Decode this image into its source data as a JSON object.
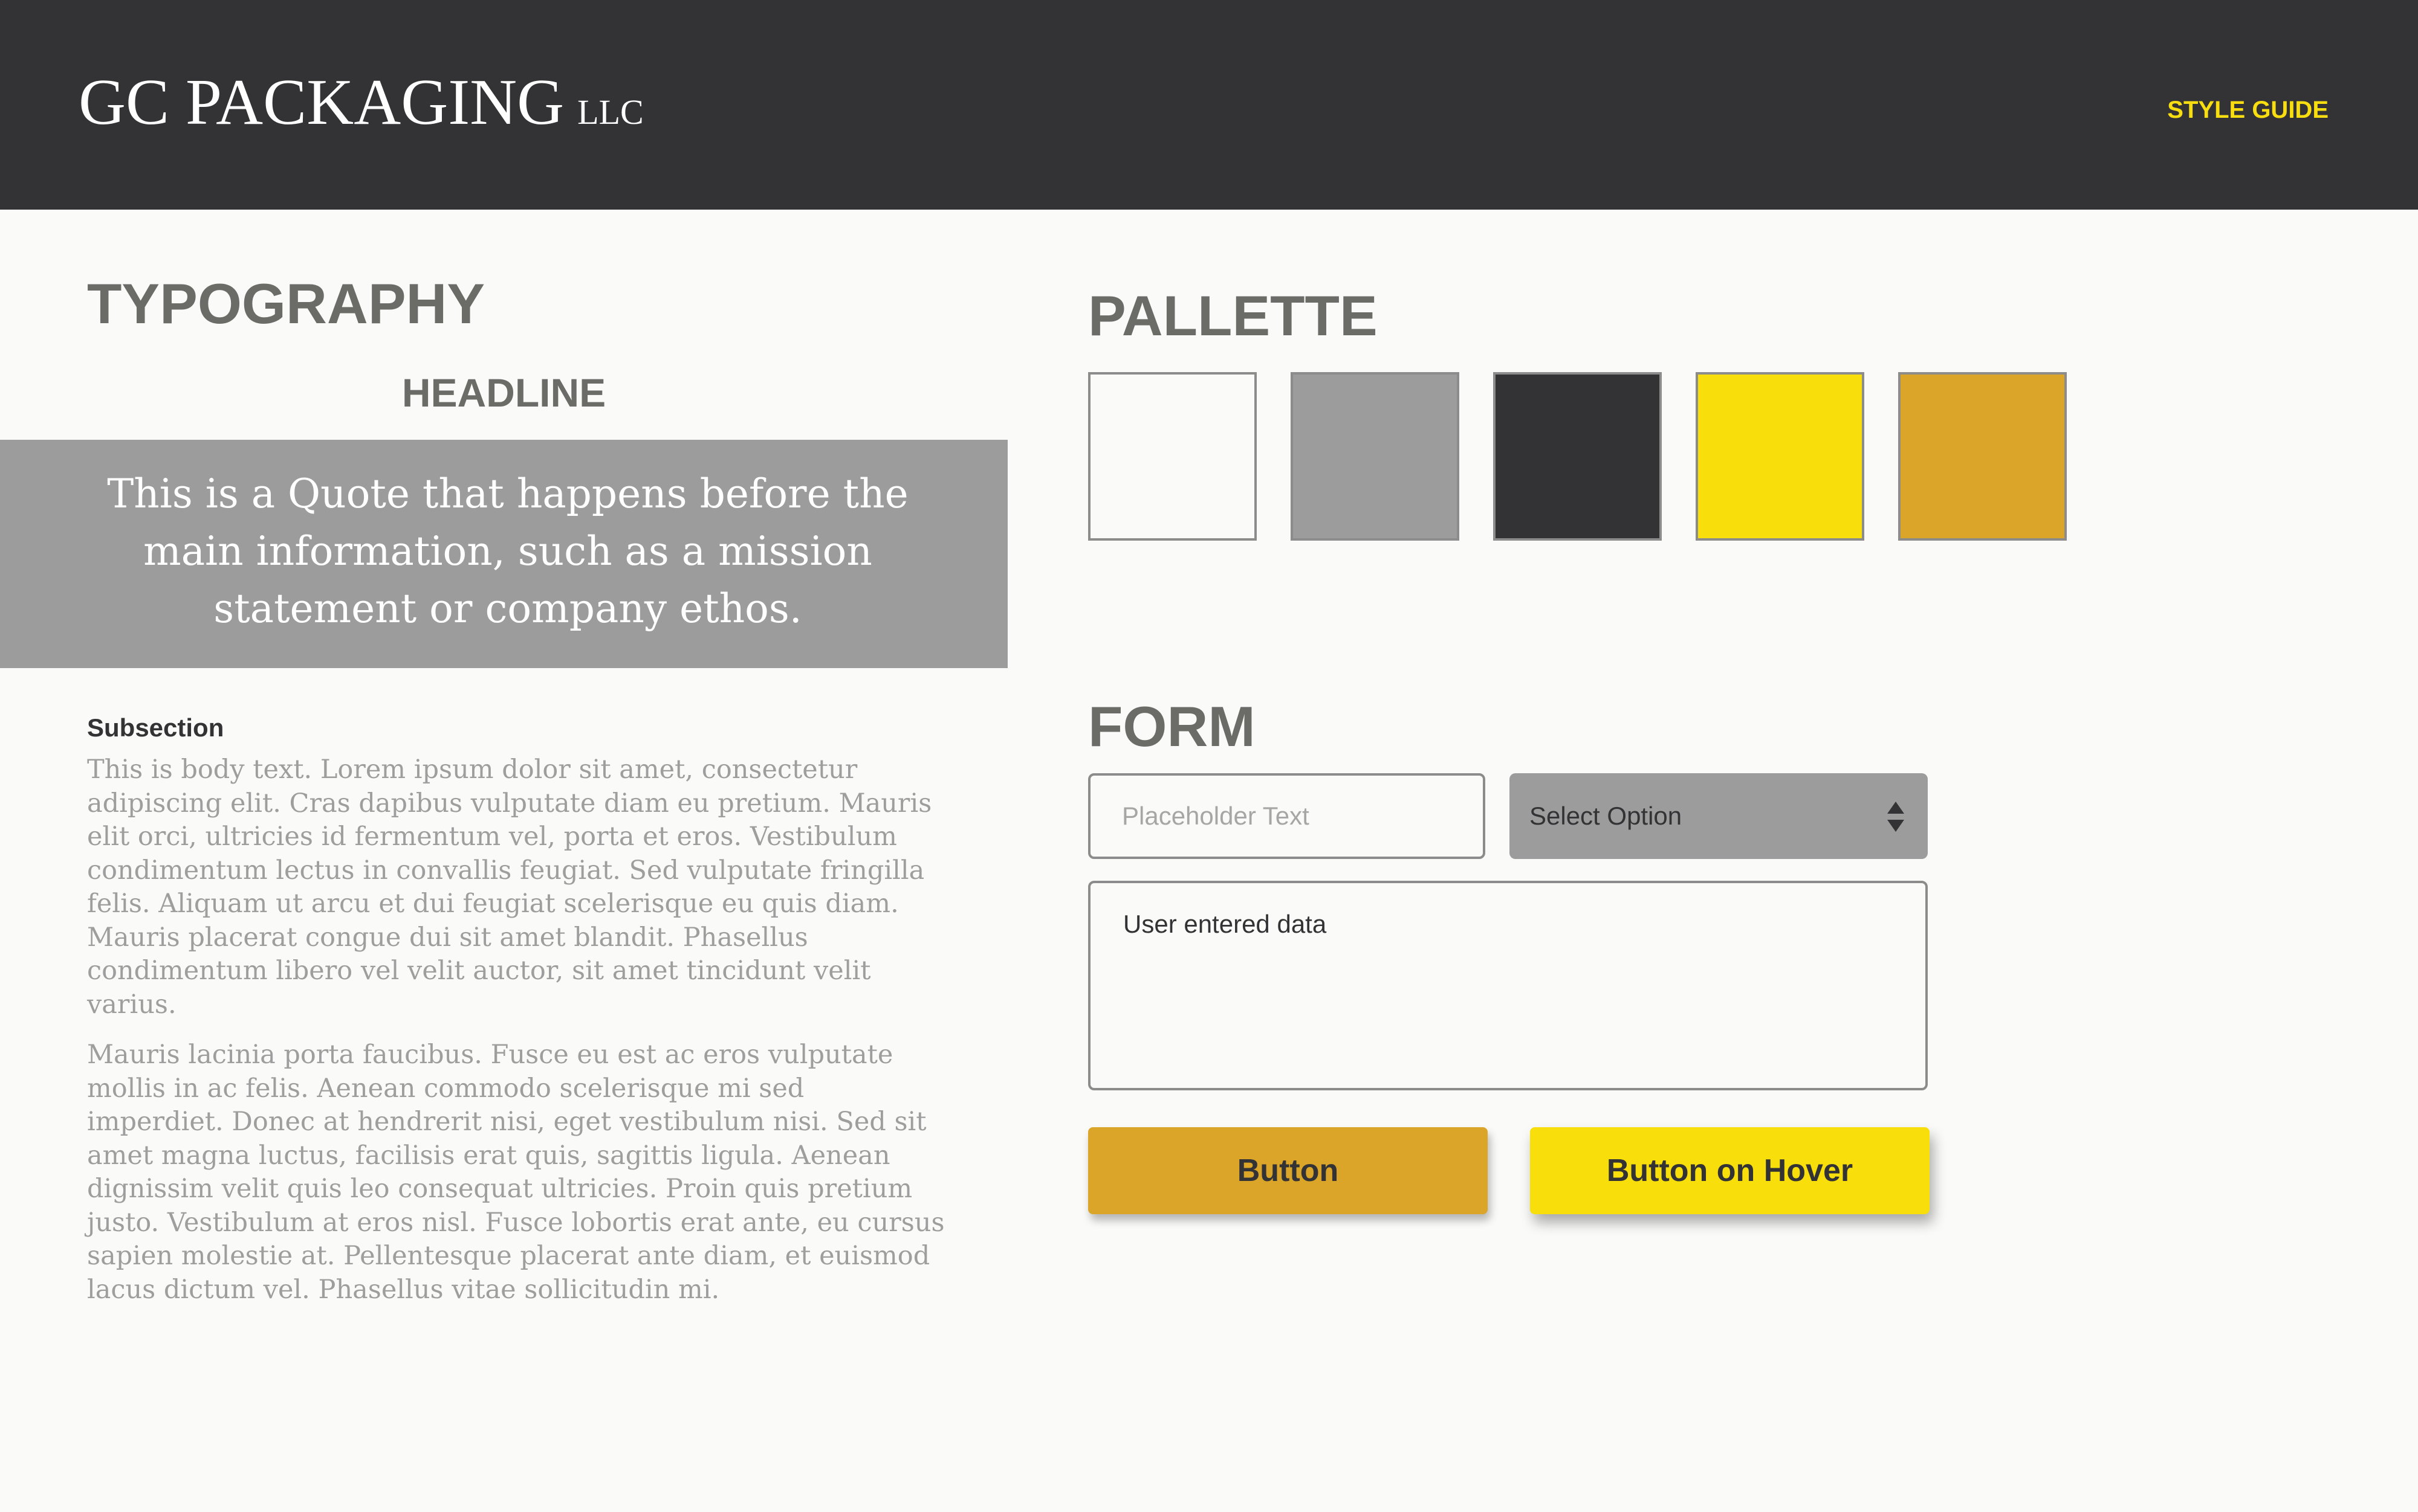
{
  "header": {
    "brand": "GC PACKAGING",
    "brand_suffix": "LLC",
    "nav_label": "STYLE GUIDE"
  },
  "typography": {
    "title": "TYPOGRAPHY",
    "headline": "HEADLINE",
    "quote": "This is a Quote that happens before the main information, such as a mission statement or company ethos.",
    "subsection": "Subsection",
    "body_paragraphs": [
      "This is body text. Lorem ipsum dolor sit amet, consectetur adipiscing elit. Cras dapibus vulputate diam eu pretium. Mauris elit orci, ultricies id fermentum vel, porta et eros. Vestibulum condimentum lectus in convallis feugiat. Sed vulputate fringilla felis. Aliquam ut arcu et dui feugiat scelerisque eu quis diam. Mauris placerat congue dui sit amet blandit. Phasellus condimentum libero vel velit auctor, sit amet tincidunt velit varius.",
      "Mauris lacinia porta faucibus. Fusce eu est ac eros vulputate mollis in ac felis. Aenean commodo scelerisque mi sed imperdiet. Donec at hendrerit nisi, eget vestibulum nisi. Sed sit amet magna luctus, facilisis erat quis, sagittis ligula. Aenean dignissim velit quis leo consequat ultricies. Proin quis pretium justo. Vestibulum at eros nisl. Fusce lobortis erat ante, eu cursus sapien molestie at. Pellentesque placerat ante diam, et euismod lacus dictum vel. Phasellus vitae sollicitudin mi."
    ]
  },
  "palette": {
    "title": "PALLETTE",
    "colors": [
      "#fafaf8",
      "#9c9c9c",
      "#333335",
      "#f8df0b",
      "#daa528"
    ]
  },
  "form": {
    "title": "FORM",
    "input_placeholder": "Placeholder Text",
    "select_value": "Select Option",
    "textarea_value": "User entered data",
    "button_label": "Button",
    "button_hover_label": "Button on Hover"
  }
}
